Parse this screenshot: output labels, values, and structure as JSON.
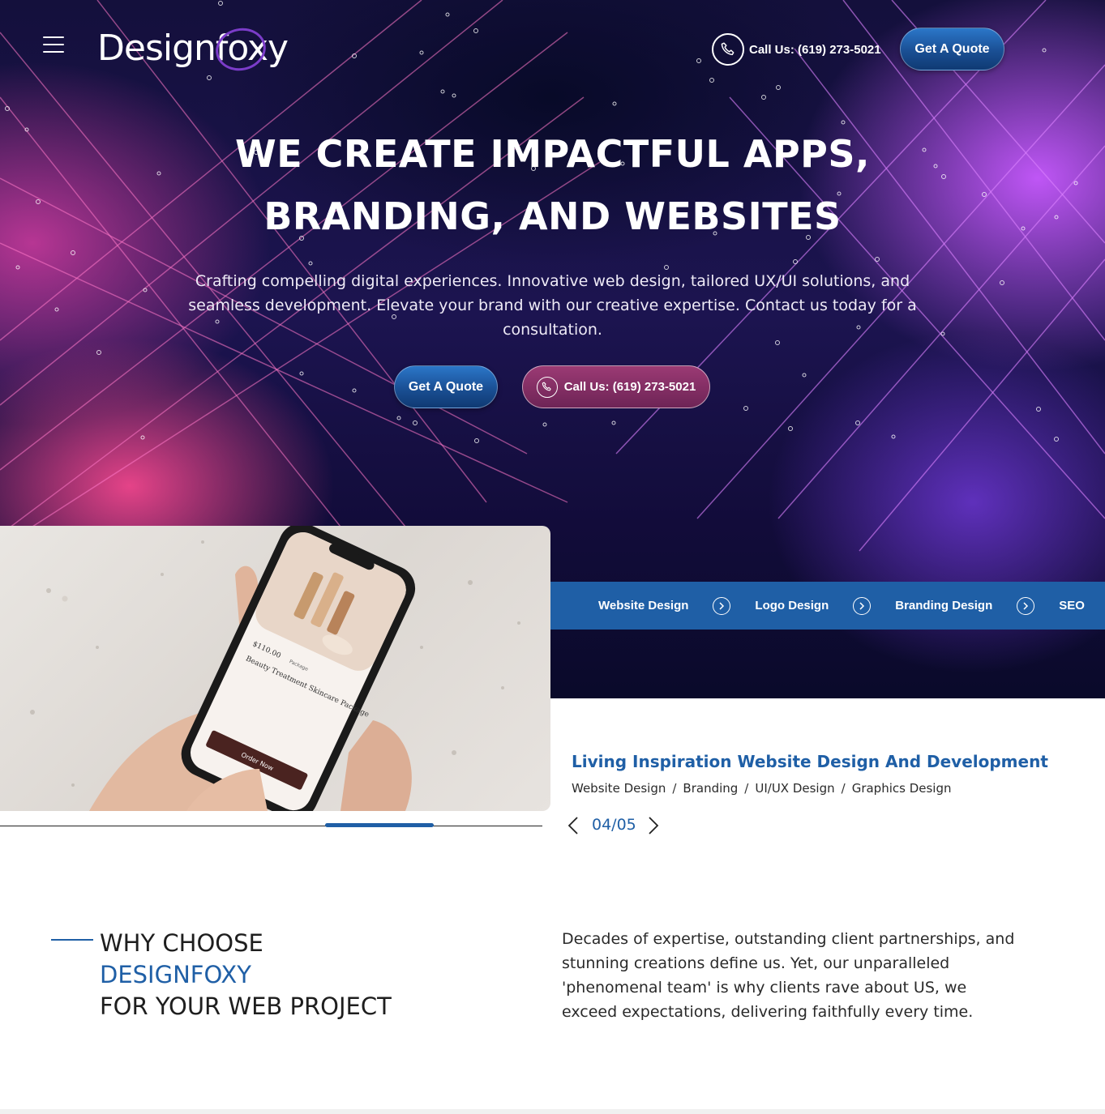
{
  "header": {
    "logo_text": "Designfoxy",
    "phone_label": "Call Us: (619) 273-5021",
    "quote_button": "Get A Quote"
  },
  "hero": {
    "title_line1": "WE CREATE IMPACTFUL APPS,",
    "title_line2": "BRANDING, AND WEBSITES",
    "subtitle": "Crafting compelling digital experiences. Innovative web design, tailored UX/UI solutions, and seamless development. Elevate your brand with our creative expertise. Contact us today for a consultation.",
    "quote_button": "Get A Quote",
    "call_button": "Call Us: (619) 273-5021"
  },
  "ticker": {
    "items": [
      "Website Design",
      "Logo Design",
      "Branding Design",
      "SEO"
    ]
  },
  "portfolio": {
    "project_title": "Living Inspiration Website Design And Development",
    "tags": [
      "Website Design",
      "Branding",
      "UI/UX Design",
      "Graphics Design"
    ],
    "counter": "04/05",
    "progress": 0.6,
    "phone_mock": {
      "price": "$110.00",
      "package_label": "Package",
      "product_name": "Beauty Treatment Skincare Package",
      "order_button": "Order Now"
    }
  },
  "why_choose": {
    "line1": "WHY CHOOSE",
    "line2": "DESIGNFOXY",
    "line3": "FOR YOUR WEB PROJECT",
    "text": "Decades of expertise, outstanding client partnerships, and stunning creations define us. Yet, our unparalleled 'phenomenal team' is why clients rave about US, we exceed expectations, delivering faithfully every time."
  },
  "colors": {
    "brand_blue": "#1f5fa6",
    "hero_dark": "#120c3a",
    "accent_magenta": "#9b3a74"
  }
}
